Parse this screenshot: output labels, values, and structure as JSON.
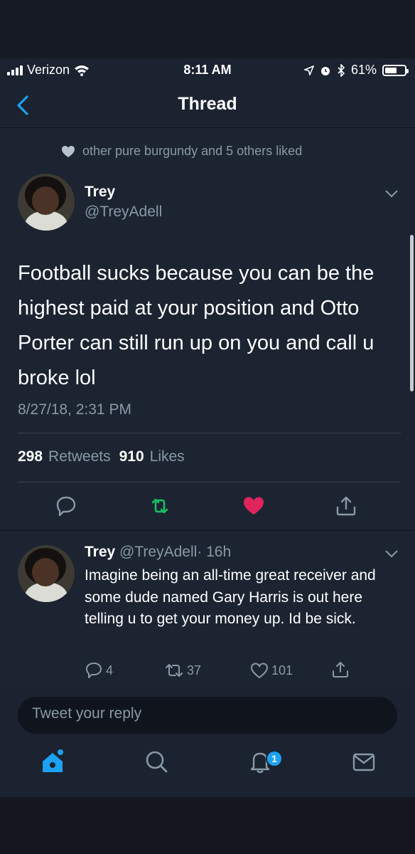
{
  "status_bar": {
    "carrier": "Verizon",
    "time": "8:11 AM",
    "battery": "61%",
    "battery_level": 0.61
  },
  "nav": {
    "title": "Thread"
  },
  "social_context": "other pure burgundy and 5 others liked",
  "main_tweet": {
    "name": "Trey",
    "handle": "@TreyAdell",
    "text": "Football sucks because you can be the highest paid at your position and Otto Porter can still run up on you and call u broke lol",
    "timestamp": "8/27/18, 2:31 PM",
    "retweets_count": "298",
    "retweets_label": "Retweets",
    "likes_count": "910",
    "likes_label": "Likes"
  },
  "reply_tweet": {
    "name": "Trey",
    "handle": "@TreyAdell",
    "time": "· 16h",
    "text": "Imagine being an all-time great receiver and some dude named Gary Harris is out here telling u to get your money up. Id be sick.",
    "replies": "4",
    "retweets": "37",
    "likes": "101"
  },
  "compose": {
    "placeholder": "Tweet your reply"
  },
  "tabbar": {
    "notifications_badge": "1"
  },
  "colors": {
    "accent": "#1da1f2",
    "retweet": "#17bf63",
    "like": "#e0245e",
    "muted": "#8899a6",
    "background": "#1c2431"
  },
  "icons": [
    "back-chevron-icon",
    "heart-icon",
    "chevron-down-icon",
    "reply-icon",
    "retweet-icon",
    "share-icon",
    "home-icon",
    "search-icon",
    "notifications-icon",
    "messages-icon",
    "wifi-icon",
    "location-icon",
    "alarm-icon",
    "bluetooth-icon"
  ]
}
